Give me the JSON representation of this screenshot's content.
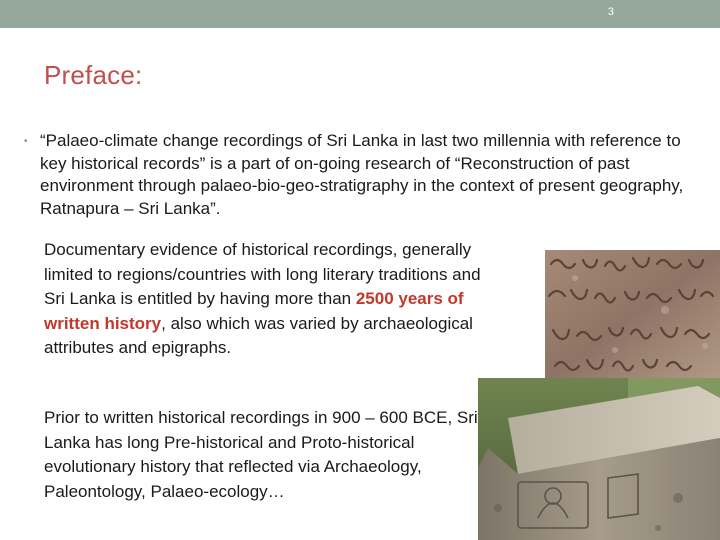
{
  "slide": {
    "number": "3"
  },
  "title": "Preface:",
  "bullet": {
    "symbol": "•",
    "text": "“Palaeo-climate change recordings of Sri Lanka in last two millennia with reference to key historical records” is a part of on-going research of “Reconstruction of past environment through palaeo-bio-geo-stratigraphy in the context of present geography, Ratnapura – Sri Lanka”."
  },
  "paragraph1": {
    "before": "Documentary evidence of historical recordings, generally limited to regions/countries with long literary traditions and Sri Lanka is entitled by having more than ",
    "highlight": "2500 years of written history",
    "after": ", also which was varied by archaeological attributes and epigraphs."
  },
  "paragraph2": "Prior to written historical recordings in 900 – 600 BCE, Sri Lanka has long Pre-historical and Proto-historical evolutionary history that reflected via Archaeology, Paleontology, Palaeo-ecology…",
  "colors": {
    "accent": "#c0504d",
    "top_bar": "#96a89c",
    "highlight": "#c0392b"
  }
}
